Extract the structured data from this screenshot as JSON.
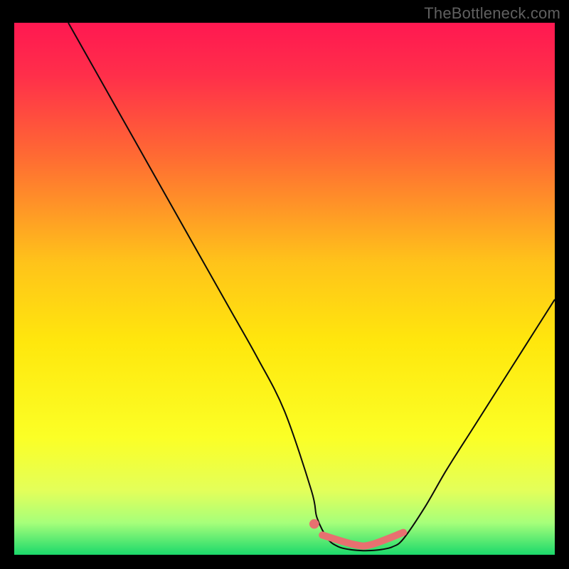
{
  "watermark": "TheBottleneck.com",
  "colors": {
    "background": "#000000",
    "curve": "#0a0a0a",
    "marker": "#e87070",
    "gradient_stops": [
      {
        "offset": 0.0,
        "color": "#ff1851"
      },
      {
        "offset": 0.1,
        "color": "#ff2f4a"
      },
      {
        "offset": 0.25,
        "color": "#ff6a33"
      },
      {
        "offset": 0.45,
        "color": "#ffc31a"
      },
      {
        "offset": 0.6,
        "color": "#ffe70d"
      },
      {
        "offset": 0.78,
        "color": "#fbff26"
      },
      {
        "offset": 0.88,
        "color": "#e3ff5a"
      },
      {
        "offset": 0.94,
        "color": "#a6ff7a"
      },
      {
        "offset": 1.0,
        "color": "#1bd96b"
      }
    ]
  },
  "chart_data": {
    "type": "line",
    "title": "",
    "xlabel": "",
    "ylabel": "",
    "xlim": [
      0,
      100
    ],
    "ylim": [
      0,
      100
    ],
    "series": [
      {
        "name": "curve",
        "x": [
          10,
          15,
          20,
          25,
          30,
          35,
          40,
          45,
          50,
          55,
          56,
          58,
          60,
          62,
          64,
          66,
          68,
          70,
          72,
          76,
          80,
          85,
          90,
          95,
          100
        ],
        "y": [
          100,
          91,
          82,
          73,
          64,
          55,
          46,
          37,
          27,
          12,
          7,
          3,
          1.5,
          1.0,
          0.8,
          0.8,
          1.0,
          1.5,
          3,
          9,
          16,
          24,
          32,
          40,
          48
        ]
      }
    ],
    "markers": [
      {
        "name": "start-dot",
        "x": 55.5,
        "y": 5.8
      },
      {
        "name": "trough-stroke",
        "x_start": 57,
        "x_end": 72,
        "y": 2.2
      }
    ]
  }
}
